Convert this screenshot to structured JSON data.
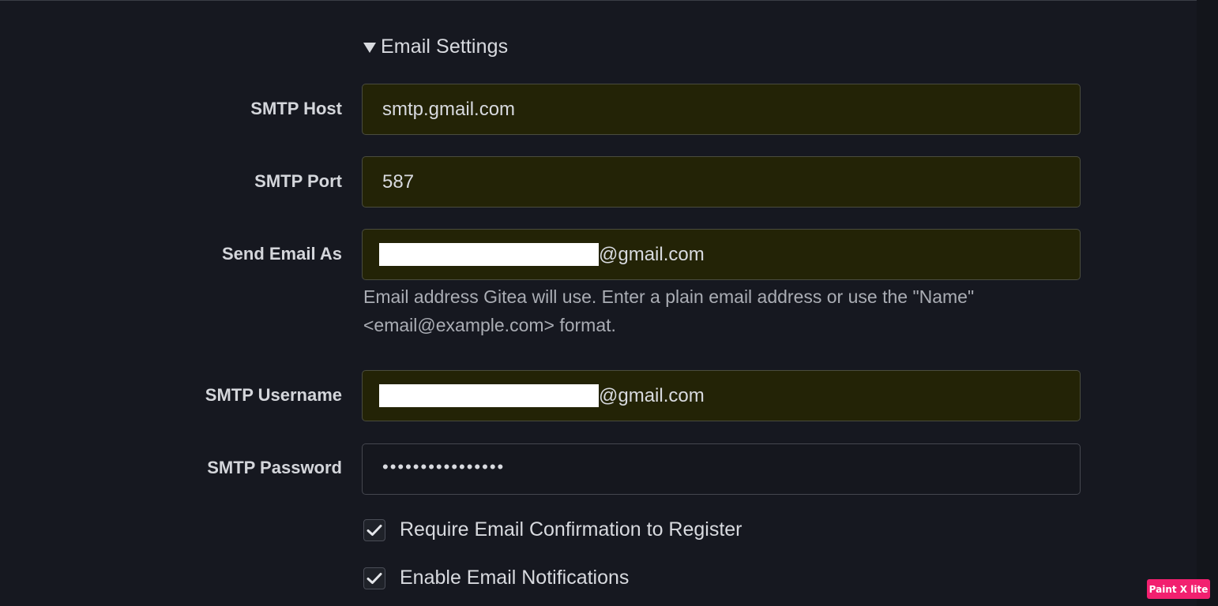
{
  "section": {
    "title": "Email Settings"
  },
  "fields": {
    "smtp_host": {
      "label": "SMTP Host",
      "value": "smtp.gmail.com"
    },
    "smtp_port": {
      "label": "SMTP Port",
      "value": "587"
    },
    "send_email_as": {
      "label": "Send Email As",
      "value_suffix": "@gmail.com",
      "help": "Email address Gitea will use. Enter a plain email address or use the \"Name\" <email@example.com> format."
    },
    "smtp_username": {
      "label": "SMTP Username",
      "value_suffix": "@gmail.com"
    },
    "smtp_password": {
      "label": "SMTP Password",
      "value": "••••••••••••••••"
    }
  },
  "checkboxes": [
    {
      "label": "Require Email Confirmation to Register",
      "checked": true
    },
    {
      "label": "Enable Email Notifications",
      "checked": true
    }
  ],
  "watermark": "Paint X lite",
  "colors": {
    "background": "#161820",
    "autofill_field": "#232306",
    "text": "#d8dadf",
    "watermark": "#f2206f"
  },
  "icons": {
    "section_toggle": "triangle-down-icon",
    "checkbox": "checkmark-icon"
  }
}
